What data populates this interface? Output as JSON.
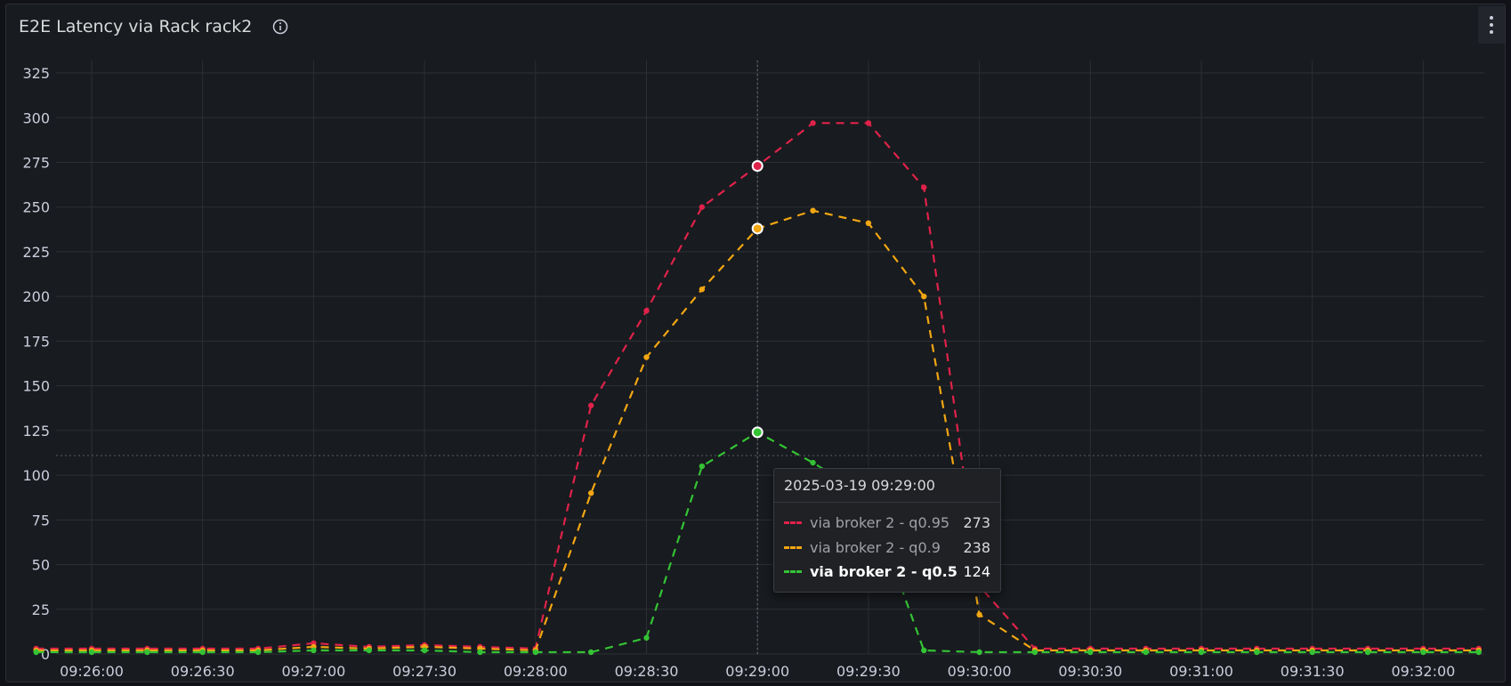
{
  "panel": {
    "title": "E2E Latency via Rack rack2",
    "info_icon": "info-circle-icon",
    "menu_icon": "vertical-ellipsis-icon"
  },
  "chart_data": {
    "type": "line",
    "title": "E2E Latency via Rack rack2",
    "xlabel": "",
    "ylabel": "",
    "x": [
      "09:25:45",
      "09:26:00",
      "09:26:15",
      "09:26:30",
      "09:26:45",
      "09:27:00",
      "09:27:15",
      "09:27:30",
      "09:27:45",
      "09:28:00",
      "09:28:15",
      "09:28:30",
      "09:28:45",
      "09:29:00",
      "09:29:15",
      "09:29:30",
      "09:29:45",
      "09:30:00",
      "09:30:15",
      "09:30:30",
      "09:30:45",
      "09:31:00",
      "09:31:15",
      "09:31:30",
      "09:31:45",
      "09:32:00",
      "09:32:15"
    ],
    "x_ticks": [
      "09:26:00",
      "09:26:30",
      "09:27:00",
      "09:27:30",
      "09:28:00",
      "09:28:30",
      "09:29:00",
      "09:29:30",
      "09:30:00",
      "09:30:30",
      "09:31:00",
      "09:31:30",
      "09:32:00"
    ],
    "ylim": [
      0,
      330
    ],
    "y_ticks": [
      0,
      25,
      50,
      75,
      100,
      125,
      150,
      175,
      200,
      225,
      250,
      275,
      300,
      325
    ],
    "grid": true,
    "threshold_line": 111,
    "series": [
      {
        "name": "via broker 2 - q0.95",
        "color": "#e0224a",
        "values": [
          3,
          3,
          3,
          3,
          3,
          6,
          4,
          5,
          4,
          3,
          139,
          192,
          250,
          273,
          297,
          297,
          261,
          38,
          3,
          3,
          3,
          3,
          3,
          3,
          3,
          3,
          3
        ]
      },
      {
        "name": "via broker 2 - q0.9",
        "color": "#f2a613",
        "values": [
          2,
          2,
          2,
          2,
          2,
          4,
          3,
          4,
          3,
          2,
          90,
          166,
          204,
          238,
          248,
          241,
          200,
          22,
          2,
          2,
          2,
          2,
          2,
          2,
          2,
          2,
          2
        ]
      },
      {
        "name": "via broker 2 - q0.5",
        "color": "#34c335",
        "values": [
          1,
          1,
          1,
          1,
          1,
          2,
          2,
          2,
          1,
          1,
          1,
          9,
          105,
          124,
          107,
          88,
          2,
          1,
          1,
          1,
          1,
          1,
          1,
          1,
          1,
          1,
          1
        ]
      }
    ],
    "hover": {
      "x": "09:29:00",
      "index": 13
    }
  },
  "tooltip": {
    "time": "2025-03-19 09:29:00",
    "rows": [
      {
        "label": "via broker 2 - q0.95",
        "value": "273",
        "color": "#e0224a"
      },
      {
        "label": "via broker 2 - q0.9",
        "value": "238",
        "color": "#f2a613"
      },
      {
        "label": "via broker 2 - q0.5",
        "value": "124",
        "color": "#34c335"
      }
    ]
  }
}
